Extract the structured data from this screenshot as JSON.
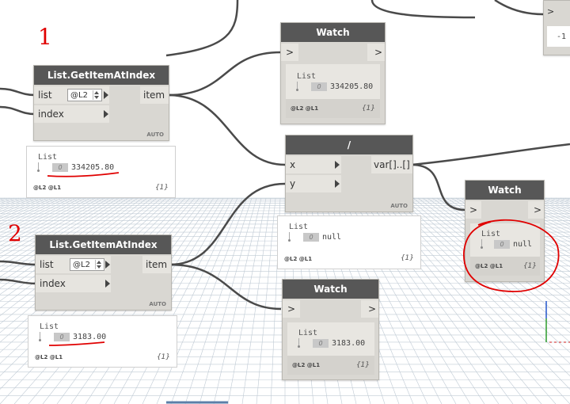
{
  "nodes": {
    "get1": {
      "title": "List.GetItemAtIndex",
      "in_list": "list",
      "in_index": "index",
      "out": "item",
      "level": "@L2",
      "lacing": "AUTO"
    },
    "get2": {
      "title": "List.GetItemAtIndex",
      "in_list": "list",
      "in_index": "index",
      "out": "item",
      "level": "@L2",
      "lacing": "AUTO"
    },
    "watch_top": {
      "title": "Watch",
      "port_in": ">",
      "port_out": ">"
    },
    "divide": {
      "title": "/",
      "in_x": "x",
      "in_y": "y",
      "out": "var[]..[]",
      "lacing": "AUTO"
    },
    "watch_right": {
      "title": "Watch",
      "port_in": ">",
      "port_out": ">"
    },
    "watch_bottom": {
      "title": "Watch",
      "port_in": ">",
      "port_out": ">"
    },
    "topright_partial": {
      "port_out": ">",
      "value": "-1"
    }
  },
  "previews": {
    "get1": {
      "list": "List",
      "index": "0",
      "value": "334205.80",
      "levels": "@L2 @L1",
      "count": "{1}"
    },
    "get2": {
      "list": "List",
      "index": "0",
      "value": "3183.00",
      "levels": "@L2 @L1",
      "count": "{1}"
    },
    "divide": {
      "list": "List",
      "index": "0",
      "value": "null",
      "levels": "@L2 @L1",
      "count": "{1}"
    },
    "watch_top": {
      "list": "List",
      "index": "0",
      "value": "334205.80",
      "levels": "@L2 @L1",
      "count": "{1}"
    },
    "watch_right": {
      "list": "List",
      "index": "0",
      "value": "null",
      "levels": "@L2 @L1",
      "count": "{1}"
    },
    "watch_bottom": {
      "list": "List",
      "index": "0",
      "value": "3183.00",
      "levels": "@L2 @L1",
      "count": "{1}"
    }
  },
  "annotations": {
    "mark1": "1",
    "mark2": "2"
  },
  "colors": {
    "header": "#575757",
    "node_body": "#d9d7d2",
    "wire": "#4a4a4a",
    "annotation": "#e00000",
    "grid": "#bfcad4"
  }
}
